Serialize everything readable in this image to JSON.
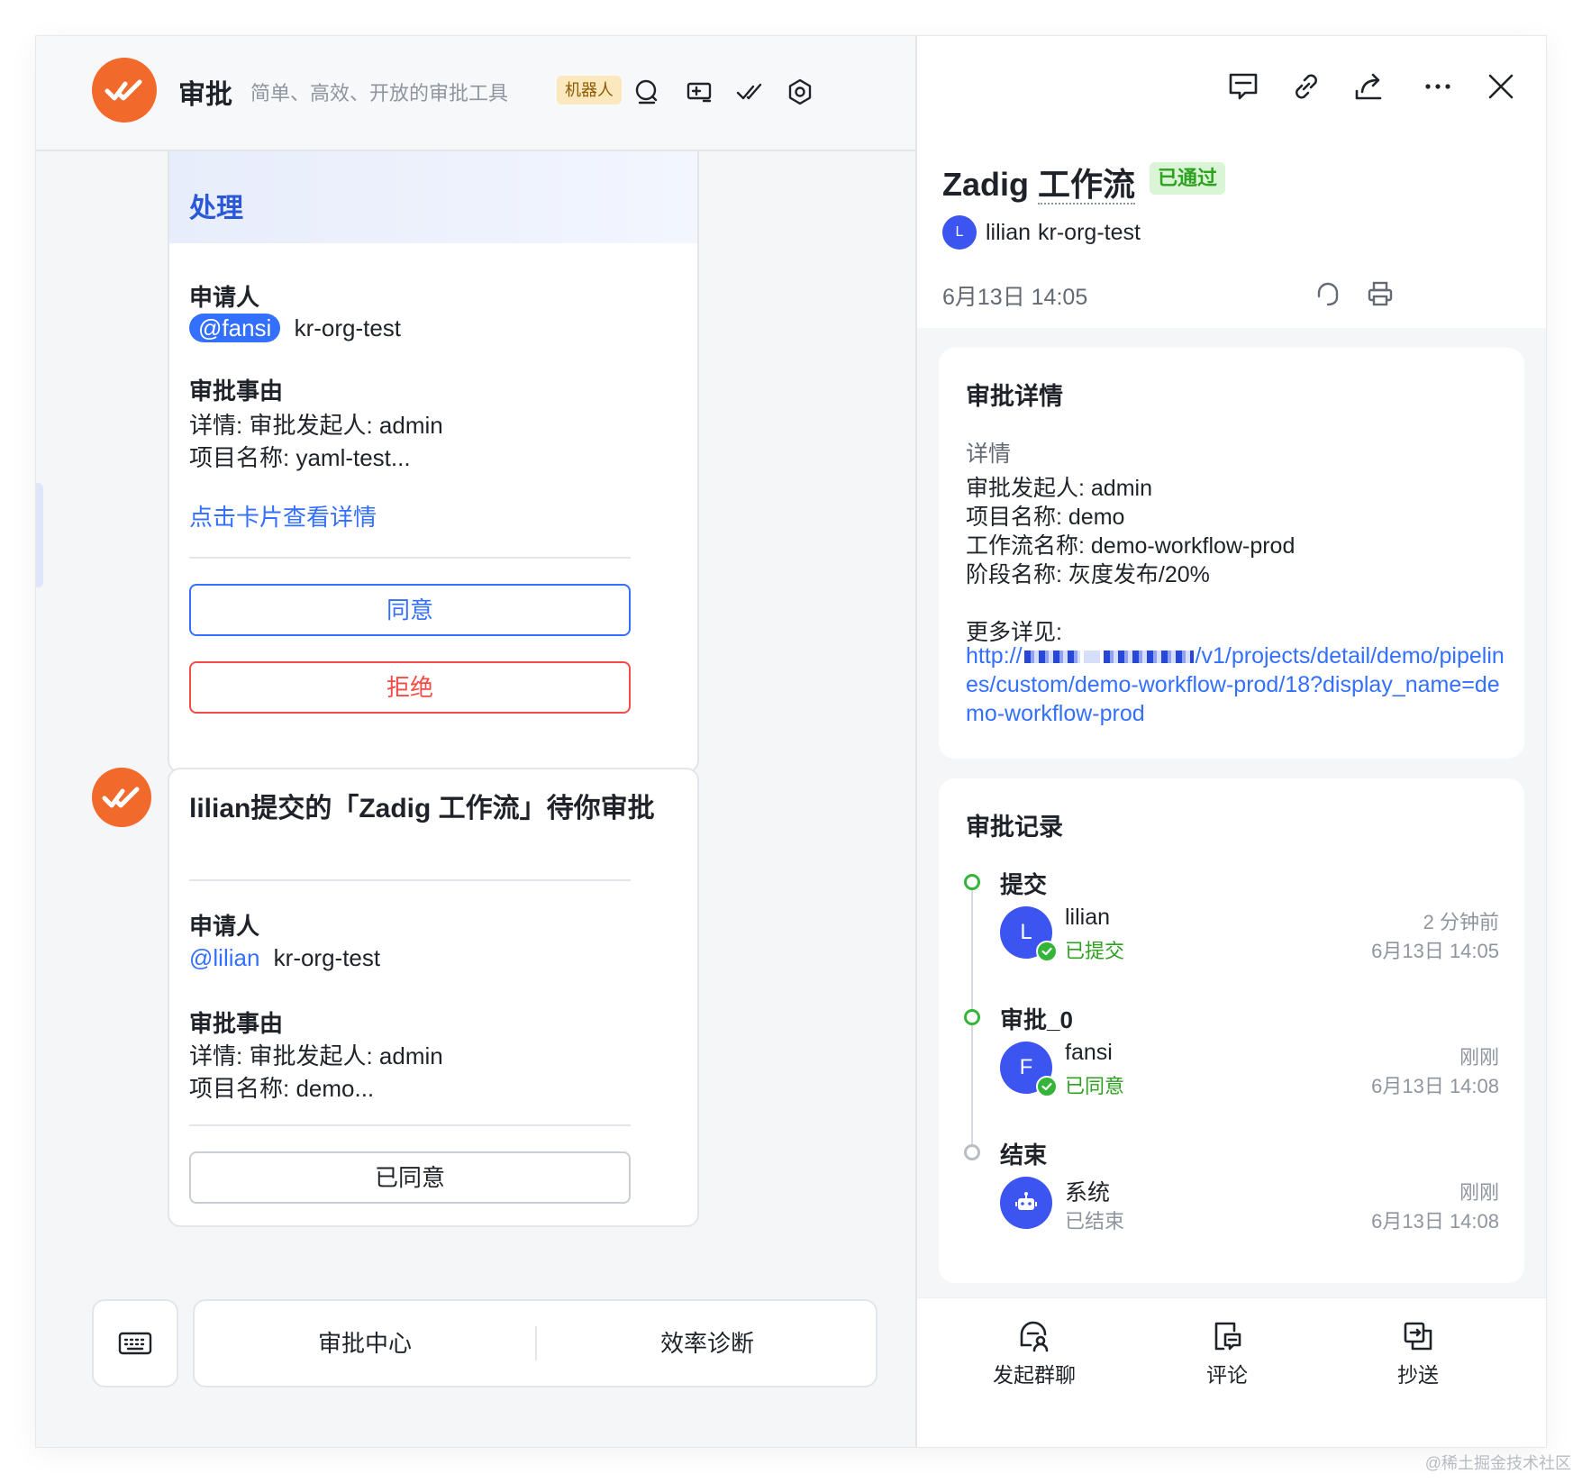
{
  "left_header": {
    "app_name": "审批",
    "subtitle": "简单、高效、开放的审批工具",
    "bot_tag": "机器人",
    "icons": [
      "search-icon",
      "add-card-icon",
      "check-done-icon",
      "gear-icon"
    ]
  },
  "card1": {
    "band_title": "处理",
    "applicant_label": "申请人",
    "applicant_mention": "@fansi",
    "applicant_org": "kr-org-test",
    "reason_label": "审批事由",
    "reason_line1": "详情: 审批发起人: admin",
    "reason_line2": "项目名称: yaml-test...",
    "view_link": "点击卡片查看详情",
    "agree_button": "同意",
    "reject_button": "拒绝"
  },
  "card2": {
    "title": "lilian提交的「Zadig 工作流」待你审批",
    "applicant_label": "申请人",
    "applicant_mention": "@lilian",
    "applicant_org": "kr-org-test",
    "reason_label": "审批事由",
    "reason_line1": "详情: 审批发起人: admin",
    "reason_line2": "项目名称: demo...",
    "agreed_button": "已同意"
  },
  "bottom_bar": {
    "keyboard_icon": "keyboard-icon",
    "item1": "审批中心",
    "item2": "效率诊断"
  },
  "right_header": {
    "icons": [
      "chat-icon",
      "link-icon",
      "share-icon",
      "more-icon",
      "close-icon"
    ],
    "title_prefix": "Zadig ",
    "title_main": "工作流",
    "status": "已通过",
    "avatar_letter": "L",
    "user_name": "lilian",
    "user_org": "kr-org-test",
    "date": "6月13日 14:05"
  },
  "detail": {
    "title": "审批详情",
    "sub": "详情",
    "line1": "审批发起人: admin",
    "line2": "项目名称: demo",
    "line3": "工作流名称: demo-workflow-prod",
    "line4": "阶段名称: 灰度发布/20%",
    "more_label": "更多详见:",
    "link_prefix": "http://",
    "link_rest": "/v1/projects/detail/demo/pipelines/custom/demo-workflow-prod/18?display_name=demo-workflow-prod"
  },
  "records": {
    "title": "审批记录",
    "steps": [
      {
        "step": "提交",
        "avatar": "L",
        "name": "lilian",
        "status": "已提交",
        "ago": "2 分钟前",
        "time": "6月13日 14:05"
      },
      {
        "step": "审批_0",
        "avatar": "F",
        "name": "fansi",
        "status": "已同意",
        "ago": "刚刚",
        "time": "6月13日 14:08"
      },
      {
        "step": "结束",
        "avatar": "",
        "name": "系统",
        "status": "已结束",
        "ago": "刚刚",
        "time": "6月13日 14:08"
      }
    ]
  },
  "footer": {
    "group_chat": "发起群聊",
    "comment": "评论",
    "cc": "抄送"
  },
  "watermark": "@稀土掘金技术社区",
  "colors": {
    "accent_blue": "#3370ff",
    "danger_red": "#f54a45",
    "success_green": "#2ea121",
    "logo_orange": "#f26a2b"
  }
}
